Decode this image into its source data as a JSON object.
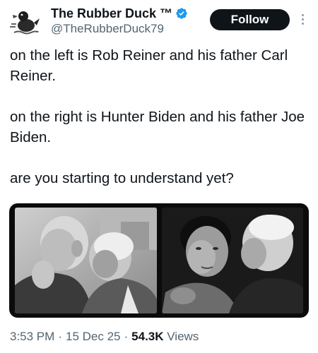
{
  "author": {
    "display_name": "The Rubber Duck ™",
    "handle": "@TheRubberDuck79",
    "verified": true,
    "avatar_icon": "rubber-duck-avatar-icon"
  },
  "actions": {
    "follow_label": "Follow",
    "more_icon": "more-vertical-icon"
  },
  "tweet": {
    "paragraphs": [
      "on the left is Rob Reiner and his father Carl Reiner.",
      "on the right is Hunter Biden and his father Joe Biden.",
      "are you starting to understand yet?"
    ]
  },
  "media": {
    "photo_count": 2,
    "style": "black-and-white"
  },
  "meta": {
    "time": "3:53 PM",
    "separator": "·",
    "date": "15 Dec 25",
    "views_count": "54.3K",
    "views_label": "Views"
  },
  "colors": {
    "text_primary": "#0f1419",
    "text_secondary": "#536471",
    "verified_blue": "#1d9bf0",
    "follow_bg": "#0f1419"
  }
}
